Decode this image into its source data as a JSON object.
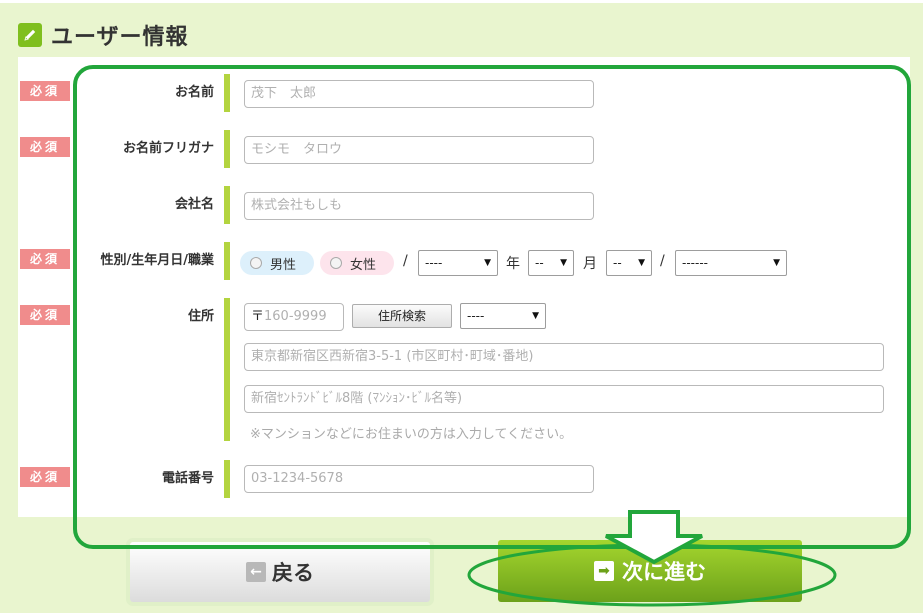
{
  "header": {
    "title": "ユーザー情報",
    "icon": "pencil-icon"
  },
  "required_label": "必須",
  "colors": {
    "page_bg": "#e9f5cf",
    "accent_green": "#7fbf1e",
    "required_badge": "#f08c8c",
    "annotation_green": "#22a63b",
    "male_bg": "#ddf0fb",
    "female_bg": "#fde4ec"
  },
  "form": {
    "name": {
      "label": "お名前",
      "placeholder": "茂下　太郎",
      "required": true
    },
    "furigana": {
      "label": "お名前フリガナ",
      "placeholder": "モシモ　タロウ",
      "required": true
    },
    "company": {
      "label": "会社名",
      "placeholder": "株式会社もしも",
      "required": false
    },
    "profile": {
      "label": "性別/生年月日/職業",
      "required": true,
      "male": "男性",
      "female": "女性",
      "slash": "/",
      "year_select": "----",
      "year_unit": "年",
      "month_select": "--",
      "month_unit": "月",
      "day_select": "--",
      "job_select": "------"
    },
    "address": {
      "label": "住所",
      "required": true,
      "zip_prefix": "〒",
      "zip_placeholder": "160-9999",
      "search_button": "住所検索",
      "pref_select": "----",
      "line1_placeholder": "東京都新宿区西新宿3-5-1 (市区町村･町域･番地)",
      "line2_placeholder": "新宿ｾﾝﾄﾗﾝﾄﾞﾋﾞﾙ8階 (ﾏﾝｼｮﾝ･ﾋﾞﾙ名等)",
      "note": "※マンションなどにお住まいの方は入力してください。"
    },
    "phone": {
      "label": "電話番号",
      "placeholder": "03-1234-5678",
      "required": true
    }
  },
  "buttons": {
    "back": "戻る",
    "next": "次に進む"
  }
}
